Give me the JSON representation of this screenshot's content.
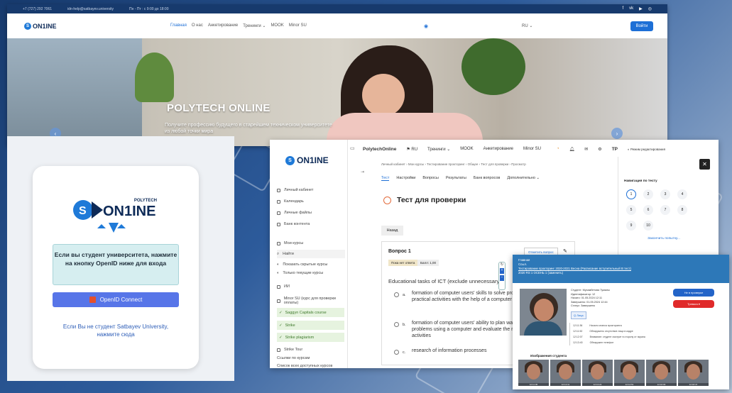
{
  "site": {
    "topbar": {
      "phone": "+7 (727) 292 7061",
      "email": "idn-help@satbayev.university",
      "hours": "Пн - Пт : с 9:00 до 18:00",
      "socials": [
        "f",
        "vk",
        "yt",
        "ig"
      ]
    },
    "logo": "ON1INE",
    "nav": [
      "Главная",
      "О нас",
      "Анкетирование",
      "Тренинги ⌄",
      "MOOK",
      "Minor SU"
    ],
    "lang": "RU ⌄",
    "login": "Войти",
    "hero_title": "POLYTECH ONLINE",
    "hero_subtitle": "Получите профессию будущего в старейшем техническом университете из любой точки мира"
  },
  "login": {
    "logo_small": "POLYTECH",
    "logo": "ON1INE",
    "notice": "Если вы студент университета, нажмите на кнопку OpenID ниже для входа",
    "button": "OpenID Connect",
    "alt": "Если Вы не студент Satbayev University, нажмите сюда"
  },
  "lms": {
    "logo": "ON1INE",
    "top": {
      "brand": "PolytechOnline",
      "lang": "RU",
      "menu": [
        "Тренинги ⌄",
        "MOOK",
        "Анкетирование",
        "Minor SU"
      ],
      "user": "TP",
      "edit_mode": "Режим редактирования"
    },
    "sidebar": [
      "Личный кабинет",
      "Календарь",
      "Личные файлы",
      "Банк контента",
      "Мои курсы",
      "Найти",
      "Показать скрытые курсы",
      "Только текущие курсы",
      "ИИ",
      "Minor SU (курс для проверки оплаты)"
    ],
    "courses": [
      "Saggyn Capitals course",
      "Strike",
      "Strike plagiarism",
      "Strike Tour"
    ],
    "sidebar_footer": [
      "Ссылки по курсам",
      "Список всех доступных курсов"
    ],
    "breadcrumbs": "Личный кабинет  ›  Мои курсы  ›  Тестирование прокторинг  ›  Общее  ›  Тест для проверки  ›  Просмотр",
    "tabs": [
      "Тест",
      "Настройки",
      "Вопросы",
      "Результаты",
      "Банк вопросов",
      "Дополнительно ⌄"
    ],
    "title": "Тест для проверки",
    "back": "Назад",
    "question": {
      "head": "Вопрос 1",
      "status": "Пока нет ответа",
      "grade": "Балл: 1,00",
      "flag": "Отметить вопрос",
      "text": "Educational tasks of ICT (exclude unnecessary)",
      "options": [
        {
          "letter": "a.",
          "text": "formation of computer users' skills to solve problems arising in practical activities with the help of a computer"
        },
        {
          "letter": "b.",
          "text": "formation of computer users' ability to plan ways of solving practical problems using a computer and evaluate the results in practical activities"
        },
        {
          "letter": "c.",
          "text": "research of information processes"
        }
      ]
    },
    "nav_panel": {
      "title": "Навигация по тесту",
      "numbers": [
        "1",
        "2",
        "3",
        "4",
        "5",
        "6",
        "7",
        "8",
        "9",
        "10"
      ],
      "finish": "Закончить попытку..."
    }
  },
  "proctoring": {
    "head_line1": "Главная",
    "head_line2": "Ссыл.",
    "head_link": "Тестирование прокторинг 2020-2021 Весна (Расписание вступительный В тест)",
    "head_line3": "2020 RS 1 ОСЕНЬ 1 (заменить)",
    "info": [
      "Студент: Мухамбетова Тумалы",
      "Идентификатор: 12",
      "Начато: 01.05.2024 12:11",
      "Завершено: 01.05.2024 12:44",
      "Статус: Завершено"
    ],
    "btn_check": "Не в проверке",
    "btn_alert": "Тревога ▾",
    "tag": "Q  Лица",
    "log": [
      {
        "time": "12:11:36",
        "text": "Начало сеанса прокторинга"
      },
      {
        "time": "12:11:52",
        "text": "Обнаружено отсутствие лица в кадре"
      },
      {
        "time": "12:12:07",
        "text": "Внимание: студент смотрит в сторону от экрана"
      },
      {
        "time": "12:13:40",
        "text": "Обнаружен телефон"
      }
    ],
    "subtitle": "Изображения студента",
    "thumbs": [
      "12:11:36",
      "12:12:11",
      "12:13:22",
      "12:14:51",
      "12:16:03",
      "12:18:47"
    ]
  }
}
